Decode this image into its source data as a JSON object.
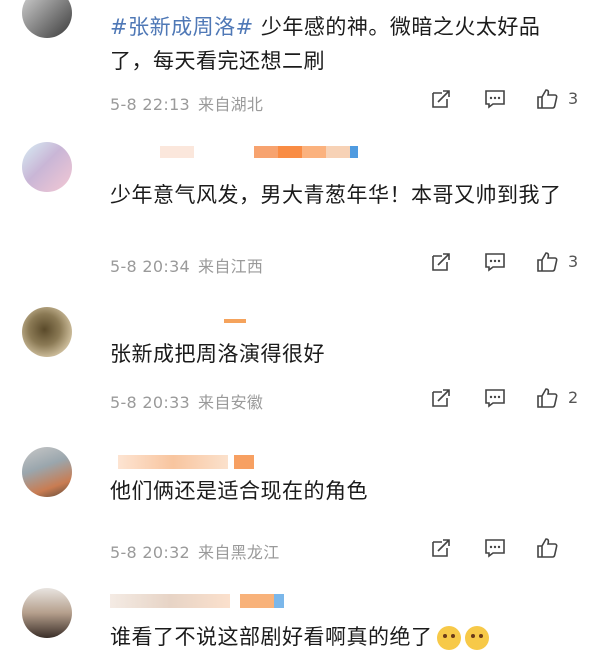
{
  "comments": [
    {
      "text_hashtag": "#张新成周洛#",
      "text": " 少年感的神。微暗之火太好品了，每天看完还想二刷",
      "time": "5-8 22:13",
      "location": "来自湖北",
      "likes": "3"
    },
    {
      "text": "少年意气风发，男大青葱年华！本哥又帅到我了",
      "time": "5-8 20:34",
      "location": "来自江西",
      "likes": "3"
    },
    {
      "text": "张新成把周洛演得很好",
      "time": "5-8 20:33",
      "location": "来自安徽",
      "likes": "2"
    },
    {
      "text": "他们俩还是适合现在的角色",
      "time": "5-8 20:32",
      "location": "来自黑龙江",
      "likes": ""
    },
    {
      "text": "谁看了不说这部剧好看啊真的绝了",
      "time": "",
      "location": "",
      "likes": ""
    }
  ],
  "icons": {
    "share": "share-square-icon",
    "comment": "comment-bubble-icon",
    "like": "thumbs-up-icon"
  },
  "colors": {
    "hashtag": "#4f78b6",
    "meta": "#9a9a9a",
    "text": "#1b1b1b"
  }
}
